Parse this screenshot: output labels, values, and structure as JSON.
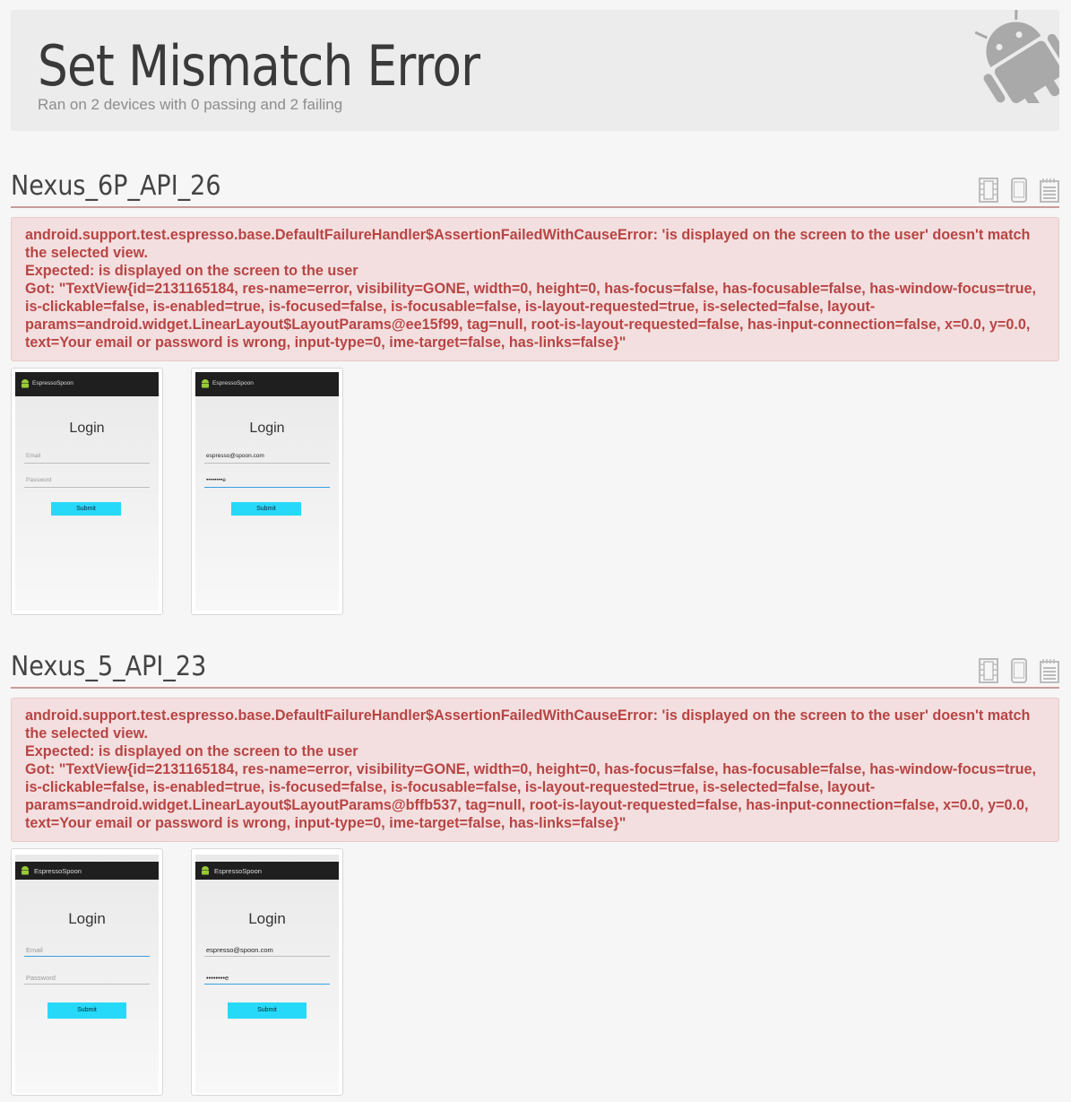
{
  "header": {
    "title": "Set Mismatch Error",
    "subtitle": "Ran on 2 devices with 0 passing and 2 failing"
  },
  "devices": [
    {
      "name": "Nexus_6P_API_26",
      "icons": [
        "film-icon",
        "phone-icon",
        "log-icon"
      ],
      "error": {
        "line1": "android.support.test.espresso.base.DefaultFailureHandler$AssertionFailedWithCauseError: 'is displayed on the screen to the user' doesn't match the selected view.",
        "line2": "Expected: is displayed on the screen to the user",
        "line3": "Got: \"TextView{id=2131165184, res-name=error, visibility=GONE, width=0, height=0, has-focus=false, has-focusable=false, has-window-focus=true, is-clickable=false, is-enabled=true, is-focused=false, is-focusable=false, is-layout-requested=true, is-selected=false, layout-params=android.widget.LinearLayout$LayoutParams@ee15f99, tag=null, root-is-layout-requested=false, has-input-connection=false, x=0.0, y=0.0, text=Your email or password is wrong, input-type=0, ime-target=false, has-links=false}\""
      },
      "screenshots": [
        {
          "app_name": "EspressoSpoon",
          "title": "Login",
          "email": "Email",
          "password": "Password",
          "submit": "Submit"
        },
        {
          "app_name": "EspressoSpoon",
          "title": "Login",
          "email": "espresso@spoon.com",
          "password": "••••••••e",
          "submit": "Submit"
        }
      ]
    },
    {
      "name": "Nexus_5_API_23",
      "icons": [
        "film-icon",
        "phone-icon",
        "log-icon"
      ],
      "error": {
        "line1": "android.support.test.espresso.base.DefaultFailureHandler$AssertionFailedWithCauseError: 'is displayed on the screen to the user' doesn't match the selected view.",
        "line2": "Expected: is displayed on the screen to the user",
        "line3": "Got: \"TextView{id=2131165184, res-name=error, visibility=GONE, width=0, height=0, has-focus=false, has-focusable=false, has-window-focus=true, is-clickable=false, is-enabled=true, is-focused=false, is-focusable=false, is-layout-requested=true, is-selected=false, layout-params=android.widget.LinearLayout$LayoutParams@bffb537, tag=null, root-is-layout-requested=false, has-input-connection=false, x=0.0, y=0.0, text=Your email or password is wrong, input-type=0, ime-target=false, has-links=false}\""
      },
      "screenshots": [
        {
          "app_name": "EspressoSpoon",
          "title": "Login",
          "email": "Email",
          "password": "Password",
          "submit": "Submit"
        },
        {
          "app_name": "EspressoSpoon",
          "title": "Login",
          "email": "espresso@spoon.com",
          "password": "••••••••e",
          "submit": "Submit"
        }
      ]
    }
  ],
  "colors": {
    "error_text": "#b84444",
    "error_bg": "#f3dfdf",
    "submit_button": "#27d9f9",
    "action_bar": "#1f1f1f"
  }
}
